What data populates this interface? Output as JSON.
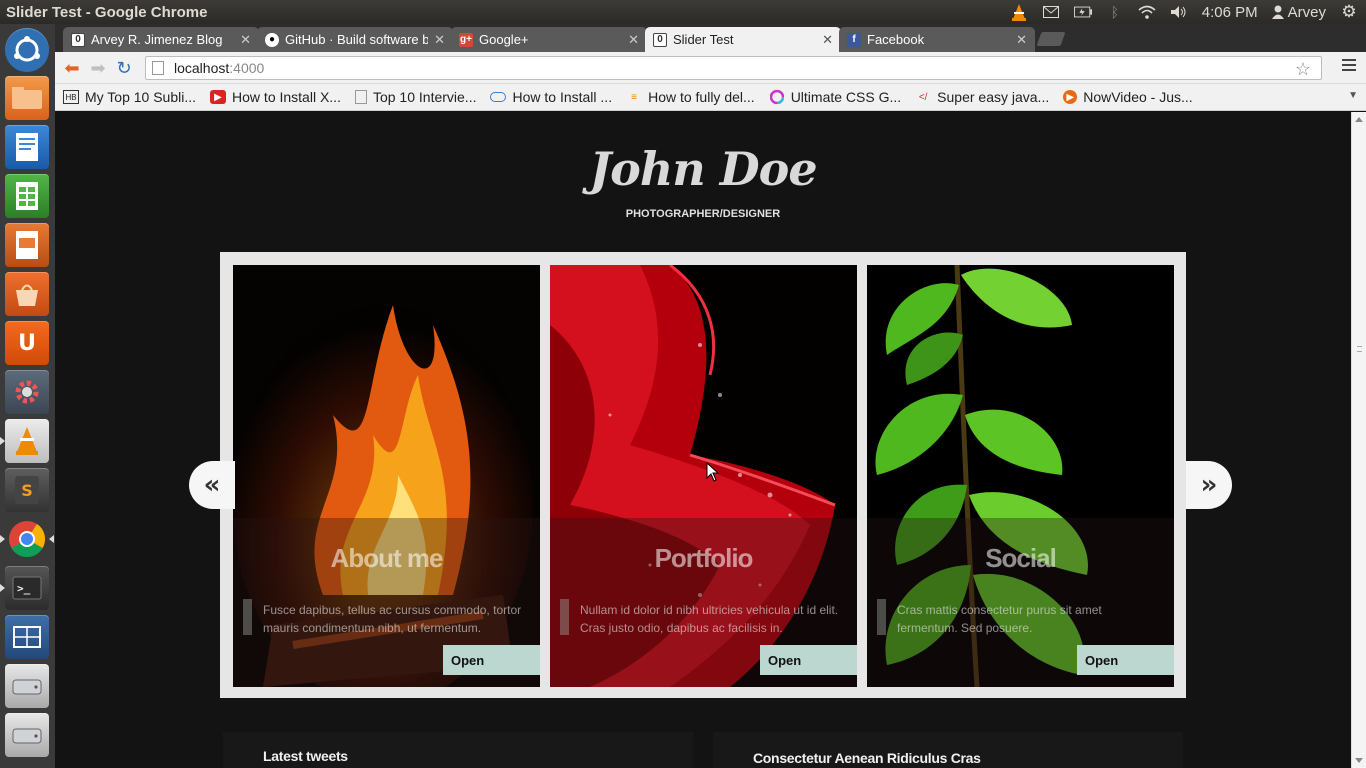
{
  "os_panel": {
    "window_title": "Slider Test - Google Chrome",
    "time": "4:06 PM",
    "user": "Arvey"
  },
  "launcher": {
    "items": [
      "dash-home",
      "files",
      "writer",
      "calc",
      "impress",
      "software-center",
      "ubuntu-one",
      "system-settings",
      "vlc",
      "sublime-text",
      "chrome",
      "terminal",
      "workspaces",
      "drive",
      "drive-2"
    ]
  },
  "browser": {
    "tabs": [
      {
        "title": "Arvey R. Jimenez Blog",
        "icon": "blog-favicon"
      },
      {
        "title": "GitHub · Build software be",
        "icon": "github-favicon"
      },
      {
        "title": "Google+",
        "icon": "gplus-favicon"
      },
      {
        "title": "Slider Test",
        "icon": "page-favicon",
        "active": true
      },
      {
        "title": "Facebook",
        "icon": "facebook-favicon"
      }
    ],
    "address": {
      "host": "localhost",
      "port": ":4000"
    },
    "bookmarks": [
      "My Top 10 Subli...",
      "How to Install X...",
      "Top 10 Intervie...",
      "How to Install ...",
      "How to fully del...",
      "Ultimate CSS G...",
      "Super easy java...",
      "NowVideo - Jus..."
    ]
  },
  "site": {
    "title": "John Doe",
    "subtitle": "PHOTOGRAPHER/DESIGNER",
    "panels": [
      {
        "title": "About me",
        "text": "Fusce dapibus, tellus ac cursus commodo, tortor mauris condimentum nibh, ut fermentum.",
        "button": "Open"
      },
      {
        "title": "Portfolio",
        "text": "Nullam id dolor id nibh ultricies vehicula ut id elit. Cras justo odio, dapibus ac facilisis in.",
        "button": "Open"
      },
      {
        "title": "Social",
        "text": "Cras mattis consectetur purus sit amet fermentum. Sed posuere.",
        "button": "Open"
      }
    ],
    "prev_arrow": "«",
    "next_arrow": "»",
    "latest_tweets": "Latest tweets",
    "right_heading": "Consectetur Aenean Ridiculus Cras"
  }
}
